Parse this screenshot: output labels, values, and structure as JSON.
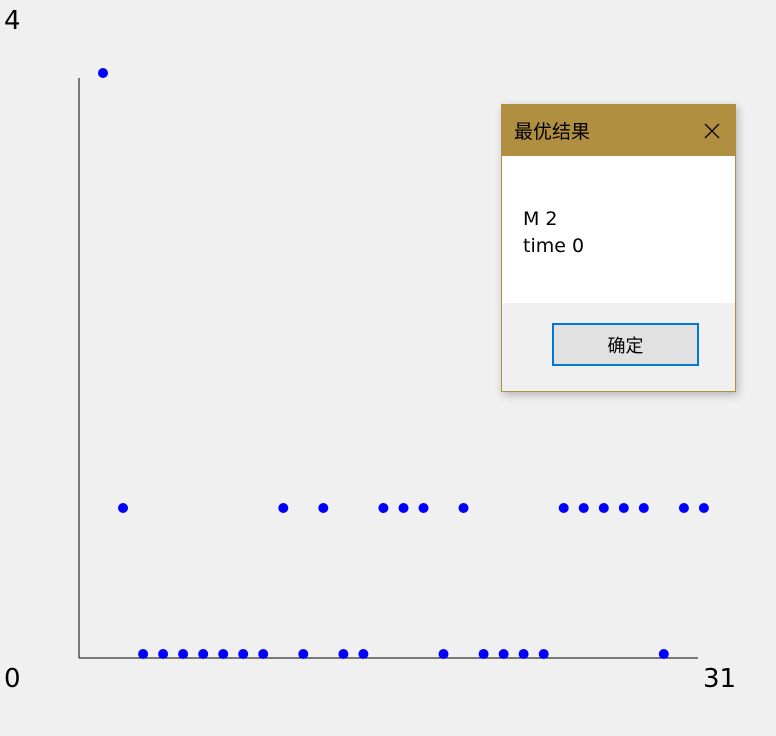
{
  "chart_data": {
    "type": "scatter",
    "title": "",
    "xlabel": "",
    "ylabel": "",
    "xlim": [
      0,
      31
    ],
    "ylim": [
      0,
      4
    ],
    "x_min_label": "0",
    "y_min_label": "0",
    "x_max_label": "31",
    "y_max_label": "4",
    "point_color": "#0000ff",
    "points": [
      {
        "x": 1,
        "y": 4
      },
      {
        "x": 2,
        "y": 1
      },
      {
        "x": 3,
        "y": 0
      },
      {
        "x": 4,
        "y": 0
      },
      {
        "x": 5,
        "y": 0
      },
      {
        "x": 6,
        "y": 0
      },
      {
        "x": 7,
        "y": 0
      },
      {
        "x": 8,
        "y": 0
      },
      {
        "x": 9,
        "y": 0
      },
      {
        "x": 10,
        "y": 1
      },
      {
        "x": 11,
        "y": 0
      },
      {
        "x": 12,
        "y": 1
      },
      {
        "x": 13,
        "y": 0
      },
      {
        "x": 14,
        "y": 0
      },
      {
        "x": 15,
        "y": 1
      },
      {
        "x": 16,
        "y": 1
      },
      {
        "x": 17,
        "y": 1
      },
      {
        "x": 18,
        "y": 0
      },
      {
        "x": 19,
        "y": 1
      },
      {
        "x": 20,
        "y": 0
      },
      {
        "x": 21,
        "y": 0
      },
      {
        "x": 22,
        "y": 0
      },
      {
        "x": 23,
        "y": 0
      },
      {
        "x": 24,
        "y": 1
      },
      {
        "x": 25,
        "y": 1
      },
      {
        "x": 26,
        "y": 1
      },
      {
        "x": 27,
        "y": 1
      },
      {
        "x": 28,
        "y": 1
      },
      {
        "x": 29,
        "y": 0
      },
      {
        "x": 30,
        "y": 1
      },
      {
        "x": 31,
        "y": 1
      }
    ]
  },
  "dialog": {
    "title": "最优结果",
    "line1": "M 2",
    "line2": "time 0",
    "ok_label": "确定",
    "close_icon": "close-icon",
    "title_bar_color": "#b08f40",
    "focus_color": "#0078d7"
  }
}
